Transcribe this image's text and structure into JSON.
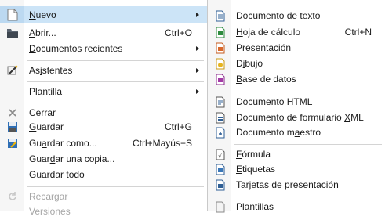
{
  "main_menu": {
    "new": {
      "pre": "",
      "mn": "N",
      "post": "uevo"
    },
    "open": {
      "pre": "",
      "mn": "A",
      "post": "brir...",
      "accel": "Ctrl+O"
    },
    "recent": {
      "pre": "",
      "mn": "D",
      "post": "ocumentos recientes"
    },
    "wizards": {
      "pre": "As",
      "mn": "i",
      "post": "stentes"
    },
    "template": {
      "pre": "Pl",
      "mn": "a",
      "post": "ntilla"
    },
    "close": {
      "pre": "",
      "mn": "C",
      "post": "errar"
    },
    "save": {
      "pre": "",
      "mn": "G",
      "post": "uardar",
      "accel": "Ctrl+G"
    },
    "save_as": {
      "pre": "Gu",
      "mn": "a",
      "post": "rdar como...",
      "accel": "Ctrl+Mayús+S"
    },
    "save_copy": {
      "pre": "Guar",
      "mn": "d",
      "post": "ar una copia..."
    },
    "save_all": {
      "pre": "Guardar ",
      "mn": "t",
      "post": "odo"
    },
    "reload": {
      "label": "Recargar"
    },
    "versions": {
      "label": "Versiones"
    }
  },
  "sub_menu": {
    "text_document": {
      "pre": "",
      "mn": "D",
      "post": "ocumento de texto"
    },
    "spreadsheet": {
      "pre": "",
      "mn": "H",
      "post": "oja de cálculo",
      "accel": "Ctrl+N"
    },
    "presentation": {
      "pre": "",
      "mn": "P",
      "post": "resentación"
    },
    "drawing": {
      "pre": "D",
      "mn": "i",
      "post": "bujo"
    },
    "database": {
      "pre": "",
      "mn": "B",
      "post": "ase de datos"
    },
    "html_document": {
      "pre": "Do",
      "mn": "c",
      "post": "umento HTML"
    },
    "xml_form": {
      "pre": "Documento de formulario ",
      "mn": "X",
      "post": "ML"
    },
    "master_document": {
      "pre": "Documento m",
      "mn": "a",
      "post": "estro"
    },
    "formula": {
      "pre": "",
      "mn": "F",
      "post": "órmula"
    },
    "labels": {
      "pre": "",
      "mn": "E",
      "post": "tiquetas"
    },
    "business_cards": {
      "pre": "Tarjetas de pre",
      "mn": "s",
      "post": "entación"
    },
    "templates": {
      "pre": "Pla",
      "mn": "n",
      "post": "tillas"
    }
  }
}
